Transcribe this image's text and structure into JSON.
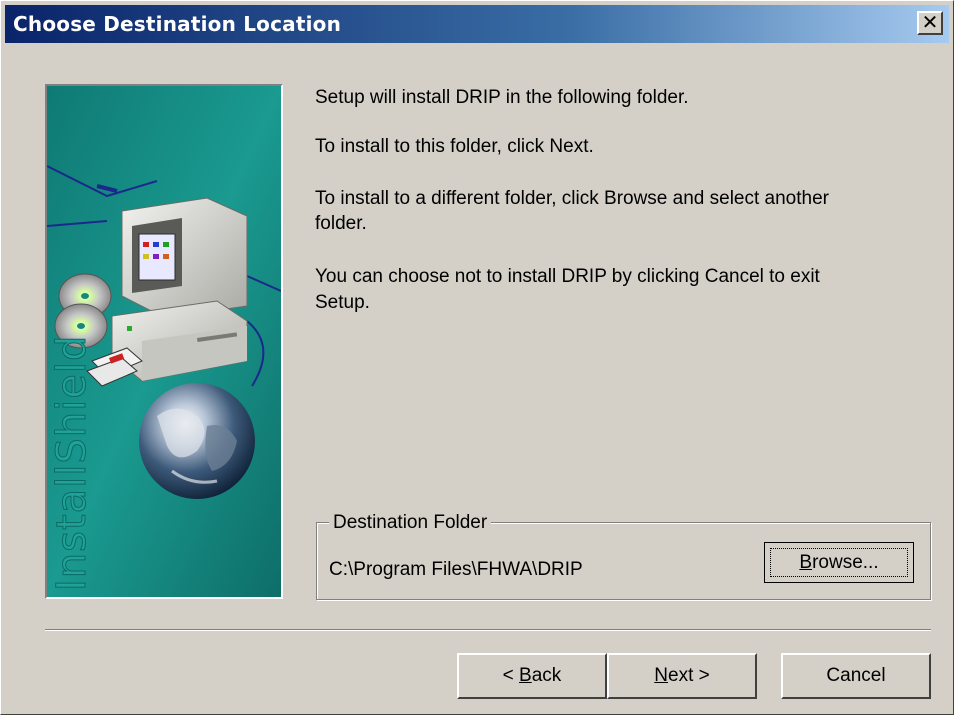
{
  "window": {
    "title": "Choose Destination Location",
    "close_label": "✕"
  },
  "side_image": {
    "brand_text": "InstallShield"
  },
  "content": {
    "line1": "Setup will install DRIP in the following folder.",
    "line2": "To install to this folder, click Next.",
    "line3a": "To install to a different folder, click Browse and select another",
    "line3b": "folder.",
    "line4a": "You can choose not to install DRIP by clicking Cancel to exit",
    "line4b": "Setup."
  },
  "destination": {
    "group_label": "Destination Folder",
    "path": "C:\\Program Files\\FHWA\\DRIP",
    "browse_mnemonic": "B",
    "browse_rest": "rowse..."
  },
  "buttons": {
    "back_prefix": "< ",
    "back_mnemonic": "B",
    "back_rest": "ack",
    "next_mnemonic": "N",
    "next_rest": "ext >",
    "cancel_label": "Cancel"
  },
  "colors": {
    "titlebar_start": "#0a246a",
    "titlebar_end": "#a6caf0",
    "dialog_face": "#d4d0c8",
    "art_background": "#15877f"
  }
}
